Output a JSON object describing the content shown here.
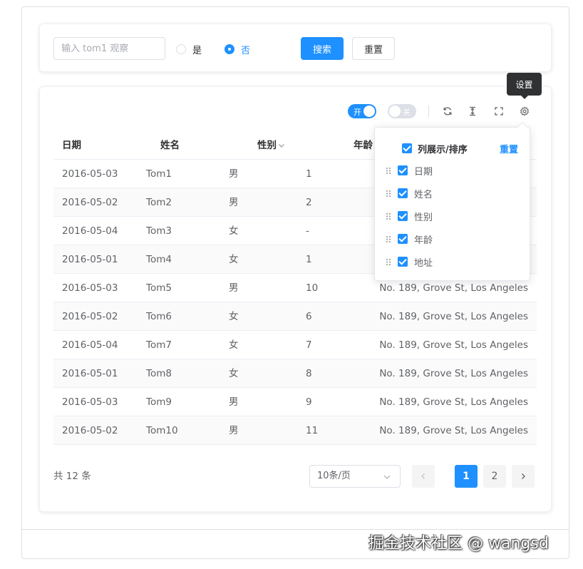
{
  "search": {
    "input_placeholder": "输入 tom1 观察",
    "radio_yes": "是",
    "radio_no": "否",
    "selected": "否",
    "search_button": "搜索",
    "reset_button": "重置"
  },
  "toolbar": {
    "switch_on_label": "开",
    "switch_off_label": "关",
    "tooltip": "设置",
    "icons": [
      "refresh-icon",
      "column-height-icon",
      "fullscreen-icon",
      "settings-icon"
    ]
  },
  "table": {
    "headers": {
      "date": "日期",
      "name": "姓名",
      "gender": "性别",
      "age": "年龄"
    },
    "rows": [
      {
        "date": "2016-05-03",
        "name": "Tom1",
        "gender": "男",
        "age": "1",
        "address": ""
      },
      {
        "date": "2016-05-02",
        "name": "Tom2",
        "gender": "男",
        "age": "2",
        "address": ""
      },
      {
        "date": "2016-05-04",
        "name": "Tom3",
        "gender": "女",
        "age": "-",
        "address": ""
      },
      {
        "date": "2016-05-01",
        "name": "Tom4",
        "gender": "女",
        "age": "1",
        "address": ""
      },
      {
        "date": "2016-05-03",
        "name": "Tom5",
        "gender": "男",
        "age": "10",
        "address": "No. 189, Grove St, Los Angeles"
      },
      {
        "date": "2016-05-02",
        "name": "Tom6",
        "gender": "女",
        "age": "6",
        "address": "No. 189, Grove St, Los Angeles"
      },
      {
        "date": "2016-05-04",
        "name": "Tom7",
        "gender": "女",
        "age": "7",
        "address": "No. 189, Grove St, Los Angeles"
      },
      {
        "date": "2016-05-01",
        "name": "Tom8",
        "gender": "女",
        "age": "8",
        "address": "No. 189, Grove St, Los Angeles"
      },
      {
        "date": "2016-05-03",
        "name": "Tom9",
        "gender": "男",
        "age": "9",
        "address": "No. 189, Grove St, Los Angeles"
      },
      {
        "date": "2016-05-02",
        "name": "Tom10",
        "gender": "男",
        "age": "11",
        "address": "No. 189, Grove St, Los Angeles"
      }
    ]
  },
  "pagination": {
    "total": "共 12 条",
    "page_size": "10条/页",
    "pages": [
      "1",
      "2"
    ],
    "current": "1"
  },
  "column_settings": {
    "header_label": "列展示/排序",
    "reset_label": "重置",
    "items": [
      "日期",
      "姓名",
      "性别",
      "年龄",
      "地址"
    ]
  },
  "watermark": "掘金技术社区 @ wangsd",
  "colors": {
    "accent": "#1e90ff",
    "border": "#dcdfe6",
    "text": "#303133"
  }
}
